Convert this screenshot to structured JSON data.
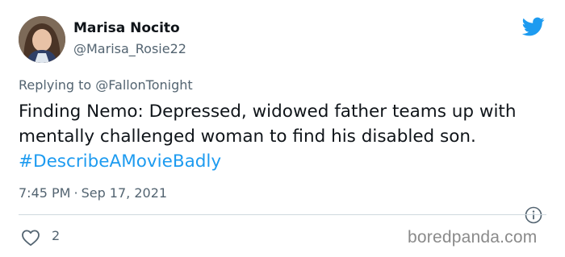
{
  "author": {
    "name": "Marisa Nocito",
    "handle": "@Marisa_Rosie22"
  },
  "reply": {
    "prefix": "Replying to ",
    "mention": "@FallonTonight"
  },
  "tweet": {
    "text": "Finding Nemo: Depressed, widowed father teams up with mentally challenged woman to find his disabled son. ",
    "hashtag": "#DescribeAMovieBadly"
  },
  "meta": {
    "time": "7:45 PM",
    "separator": "·",
    "date": "Sep 17, 2021"
  },
  "actions": {
    "like_count": "2"
  },
  "watermark": "boredpanda.com",
  "colors": {
    "accent": "#1d9bf0",
    "secondary_text": "#536471"
  },
  "icons": {
    "brand": "twitter-bird-icon",
    "info": "info-icon",
    "like": "heart-icon"
  }
}
